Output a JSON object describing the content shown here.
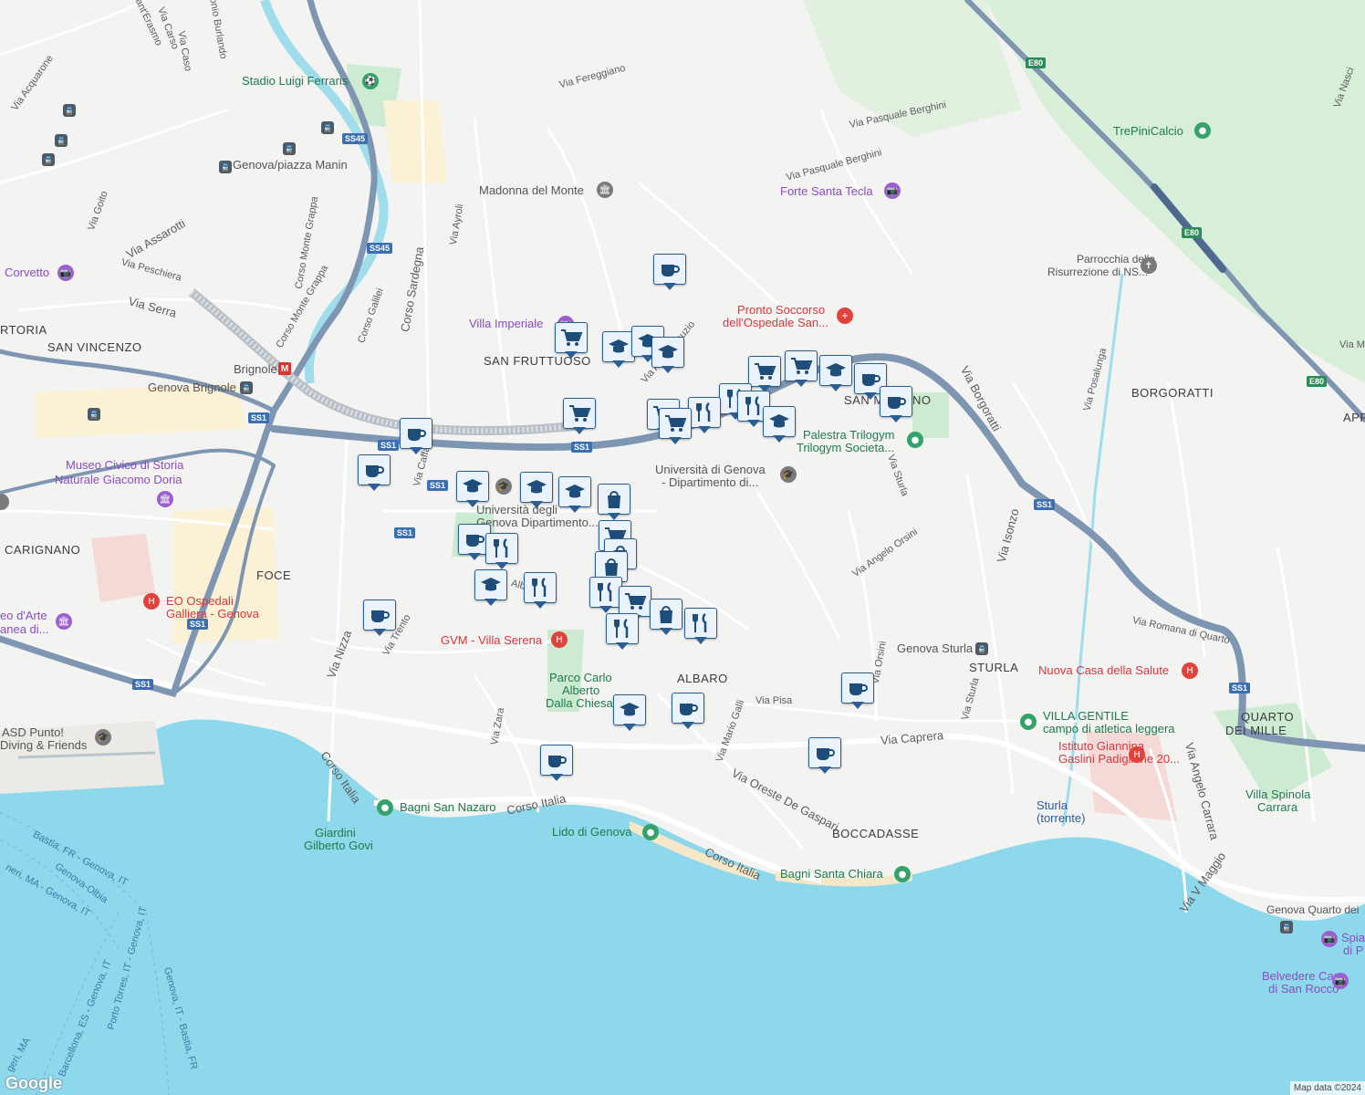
{
  "map": {
    "attribution": "Map data ©2024",
    "logo": "Google",
    "colors": {
      "land": "#f3f3f1",
      "sea": "#8ed8ec",
      "park": "#cdebd2",
      "highway": "#7e96b2",
      "road": "#ffffff",
      "marker_fill": "#eaf2fb",
      "marker_border": "#2b5f93"
    }
  },
  "labels": {
    "stadio": "Stadio Luigi Ferraris",
    "madonna": "Madonna del Monte",
    "forte": "Forte Santa Tecla",
    "trepini": "TrePiniCalcio",
    "parrocchia1": "Parrocchia della",
    "parrocchia2": "Risurrezione di NS...",
    "pronto1": "Pronto Soccorso",
    "pronto2": "dell'Ospedale San...",
    "villa_imperiale": "Villa Imperiale",
    "corvetto": "Corvetto",
    "san_vincenzo": "SAN VINCENZO",
    "san_fruttuoso": "SAN FRUTTUOSO",
    "san_martino": "SAN MARTINO",
    "borgoratti": "BORGORATTI",
    "apparizione": "APP",
    "brignole": "Brignole",
    "genova_brignole": "Genova Brignole",
    "piazza_manin": "Genova/piazza Manin",
    "museo1": "Museo Civico di Storia",
    "museo2": "Naturale Giacomo Doria",
    "carignano": "CARIGNANO",
    "foce": "FOCE",
    "ospedali1": "EO Ospedali",
    "ospedali2": "Galliera - Genova",
    "arte1": "eo d'Arte",
    "arte2": "anea di...",
    "torria": "RTORIA",
    "palestra1": "Palestra Trilogym",
    "palestra2": "Trilogym Societa...",
    "universita1": "Università di Genova",
    "universita2": "- Dipartimento di...",
    "uni_ligure1": "Università degli",
    "uni_ligure2": "Genova Dipartimento...",
    "gvm": "GVM - Villa Serena",
    "parco1": "Parco Carlo",
    "parco2": "Alberto",
    "parco3": "Dalla Chiesa",
    "albaro": "ALBARO",
    "genova_sturla": "Genova Sturla",
    "sturla": "STURLA",
    "nuova_casa": "Nuova Casa della Salute",
    "villa_gentile1": "VILLA GENTILE",
    "villa_gentile2": "campo di atletica leggera",
    "gaslini1": "Istituto Giannina",
    "gaslini2": "Gaslini Padiglione 20...",
    "quarto1": "QUARTO",
    "quarto2": "DEI MILLE",
    "villa_spinola1": "Villa Spinola",
    "villa_spinola2": "Carrara",
    "sturla_torr1": "Sturla",
    "sturla_torr2": "(torrente)",
    "boccadasse": "BOCCADASSE",
    "bagni_santa_chiara": "Bagni Santa Chiara",
    "lido": "Lido di Genova",
    "bagni_san_nazaro": "Bagni San Nazaro",
    "giardini1": "Giardini",
    "giardini2": "Gilberto Govi",
    "asd1": "ASD Punto!",
    "asd2": "Diving & Friends",
    "quarto_station": "Genova Quarto dei",
    "belvedere1": "Belvedere Capo",
    "belvedere2": "di San Rocco",
    "spia": "Spia",
    "spia2": "di P"
  },
  "streets": {
    "via_fereggiano": "Via Fereggiano",
    "via_berghini1": "Via Pasquale Berghini",
    "via_berghini2": "Via Pasquale Berghini",
    "via_assarotti": "Via Assarotti",
    "via_peschiera": "Via Peschiera",
    "via_serra": "Via Serra",
    "via_acquarone": "Via Acquarone",
    "via_goito": "Via Goito",
    "via_caso": "Via Caso",
    "via_burlando": "onio Burlando",
    "sant_erasmo": "Sant'Erasmo",
    "via_carso": "Via Carso",
    "corso_monte_grappa1": "Corso Monte Grappa",
    "corso_monte_grappa2": "Corso Monte Grappa",
    "corso_galilei": "Corso Galilei",
    "corso_sardegna": "Corso Sardegna",
    "via_ayroli": "Via Ayroli",
    "via_manuzio": "Via Aldo Manuzio",
    "via_borgoratti": "Via Borgoratti",
    "via_posalunga": "Via Posalunga",
    "via_nascio": "Via Nasci",
    "via_m": "Via M",
    "via_sturla": "Via Sturla",
    "via_angelo_orsini": "Via Angelo Orsini",
    "via_isonzo": "Via Isonzo",
    "via_romana": "Via Romana di Quarto",
    "via_sturla2": "Via Sturla",
    "via_orsini2": "Via Orsini",
    "via_pisa": "Via Pisa",
    "via_caprera": "Via Caprera",
    "via_mario_galli": "Via Mario Galli",
    "via_de_gaspari": "Via Oreste De Gaspari",
    "corso_italia1": "Corso Italia",
    "corso_italia2": "Corso Italia",
    "corso_italia3": "Corso Italia",
    "via_zara": "Via Zara",
    "via_nizza": "Via Nizza",
    "via_trento": "Via Trento",
    "via_caffaro": "Via Caffa",
    "via_alb": "Alb",
    "via_angelo_carrara": "Via Angelo Carrara",
    "via_v_maggio": "Via V Maggio",
    "via_ss1": "Via"
  },
  "sea_routes": {
    "r1": "Bastia, FR - Genova, IT",
    "r2": "Genova-Olbia",
    "r3": "neri, MA - Genova, IT",
    "r4": "Porto Torres, IT - Genova, IT",
    "r5": "Barcellona, ES - Genova, IT",
    "r6": "Genova, IT - Bastia, FR",
    "r7": "geri, MA"
  },
  "shields": {
    "ss45a": "SS45",
    "ss45b": "SS45",
    "ss1a": "SS1",
    "ss1b": "SS1",
    "ss1c": "SS1",
    "ss1d": "SS1",
    "ss1e": "SS1",
    "ss1f": "SS1",
    "ss1g": "SS1",
    "ss1h": "SS1",
    "e80a": "E80",
    "e80b": "E80",
    "e80c": "E80"
  },
  "markers": [
    {
      "type": "cafe"
    },
    {
      "type": "shopping-cart"
    },
    {
      "type": "school"
    },
    {
      "type": "school"
    },
    {
      "type": "school"
    },
    {
      "type": "shopping-cart"
    },
    {
      "type": "shopping-cart"
    },
    {
      "type": "school"
    },
    {
      "type": "cafe"
    },
    {
      "type": "cafe"
    },
    {
      "type": "restaurant"
    },
    {
      "type": "restaurant"
    },
    {
      "type": "shopping-cart"
    },
    {
      "type": "restaurant"
    },
    {
      "type": "shopping-cart"
    },
    {
      "type": "school"
    },
    {
      "type": "shopping-cart"
    },
    {
      "type": "cafe"
    },
    {
      "type": "cafe"
    },
    {
      "type": "school"
    },
    {
      "type": "school"
    },
    {
      "type": "school"
    },
    {
      "type": "shopping-bag"
    },
    {
      "type": "cafe"
    },
    {
      "type": "restaurant"
    },
    {
      "type": "school"
    },
    {
      "type": "restaurant"
    },
    {
      "type": "shopping-cart"
    },
    {
      "type": "shopping-bag"
    },
    {
      "type": "shopping-bag"
    },
    {
      "type": "restaurant"
    },
    {
      "type": "shopping-cart"
    },
    {
      "type": "shopping-bag"
    },
    {
      "type": "restaurant"
    },
    {
      "type": "restaurant"
    },
    {
      "type": "cafe"
    },
    {
      "type": "school"
    },
    {
      "type": "cafe"
    },
    {
      "type": "cafe"
    },
    {
      "type": "cafe"
    },
    {
      "type": "cafe"
    }
  ]
}
